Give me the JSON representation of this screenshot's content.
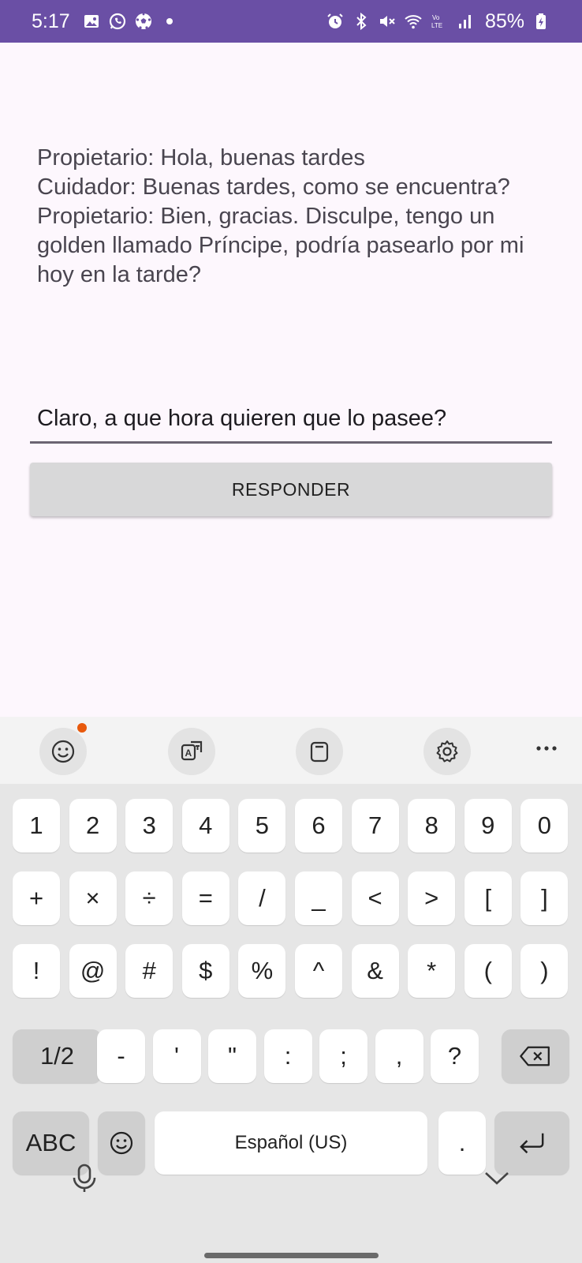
{
  "status_bar": {
    "time": "5:17",
    "battery": "85%",
    "bg_color": "#6a4fa5",
    "left_icons": [
      "gallery-icon",
      "whatsapp-icon",
      "soccer-ball-icon",
      "dot-icon"
    ],
    "right_icons": [
      "alarm-icon",
      "bluetooth-icon",
      "mute-icon",
      "wifi-icon",
      "volte-icon",
      "signal-icon",
      "battery-charging-icon"
    ]
  },
  "conversation": {
    "text": "Propietario: Hola, buenas tardes\nCuidador: Buenas tardes, como se encuentra?\nPropietario: Bien, gracias. Disculpe, tengo un golden llamado Príncipe, podría pasearlo por mi hoy en la tarde?"
  },
  "reply": {
    "value": "Claro, a que hora quieren que lo pasee?"
  },
  "respond_button": {
    "label": "RESPONDER"
  },
  "keyboard": {
    "toolbar": {
      "icons": [
        "emoji-icon",
        "translate-icon",
        "clipboard-icon",
        "settings-icon",
        "more-icon"
      ],
      "more_label": "···"
    },
    "row1": [
      "1",
      "2",
      "3",
      "4",
      "5",
      "6",
      "7",
      "8",
      "9",
      "0"
    ],
    "row2": [
      "+",
      "×",
      "÷",
      "=",
      "/",
      "_",
      "<",
      ">",
      "[",
      "]"
    ],
    "row3": [
      "!",
      "@",
      "#",
      "$",
      "%",
      "^",
      "&",
      "*",
      "(",
      ")"
    ],
    "row4": {
      "shift_label": "1/2",
      "keys": [
        "-",
        "'",
        "\"",
        ":",
        ";",
        ",",
        "?"
      ]
    },
    "row5": {
      "abc_label": "ABC",
      "space_label": "Español (US)",
      "period": "."
    },
    "bottom_icons": [
      "microphone-icon",
      "chevron-down-icon"
    ]
  }
}
